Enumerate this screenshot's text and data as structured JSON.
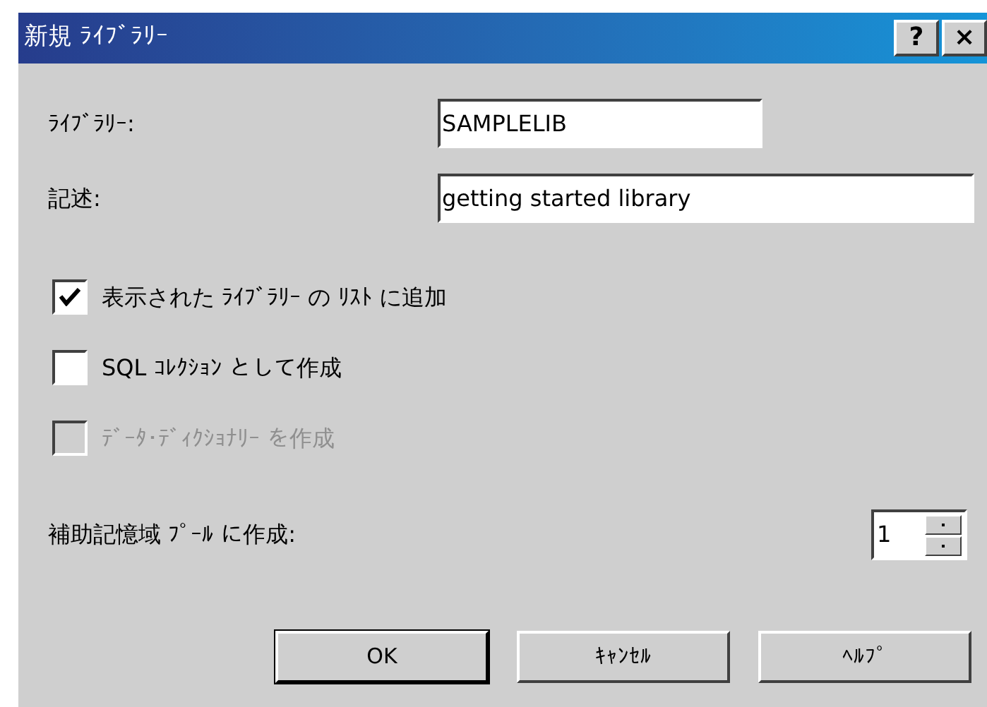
{
  "window": {
    "title": "新規 ﾗｲﾌﾞﾗﾘｰ",
    "title_buttons": [
      "?",
      "×"
    ]
  },
  "fields": [
    {
      "label": "ﾗｲﾌﾞﾗﾘｰ:",
      "value": "SAMPLELIB",
      "wide": false
    },
    {
      "label": "記述:",
      "value": "getting started library",
      "wide": true
    }
  ],
  "checkboxes": [
    {
      "label": "表示された ﾗｲﾌﾞﾗﾘｰ の ﾘｽﾄ に追加",
      "checked": true,
      "disabled": false
    },
    {
      "label": "SQL ｺﾚｸｼｮﾝ として作成",
      "checked": false,
      "disabled": false
    },
    {
      "label": "ﾃﾞｰﾀ･ﾃﾞｨｸｼｮﾅﾘｰ を作成",
      "checked": false,
      "disabled": true
    }
  ],
  "pool": {
    "label": "補助記憶域 ﾌﾟｰﾙ に作成:",
    "value": "1"
  },
  "buttons": [
    {
      "label": "OK",
      "default": true
    },
    {
      "label": "ｷｬﾝｾﾙ",
      "default": false
    },
    {
      "label": "ﾍﾙﾌﾟ",
      "default": false
    }
  ]
}
